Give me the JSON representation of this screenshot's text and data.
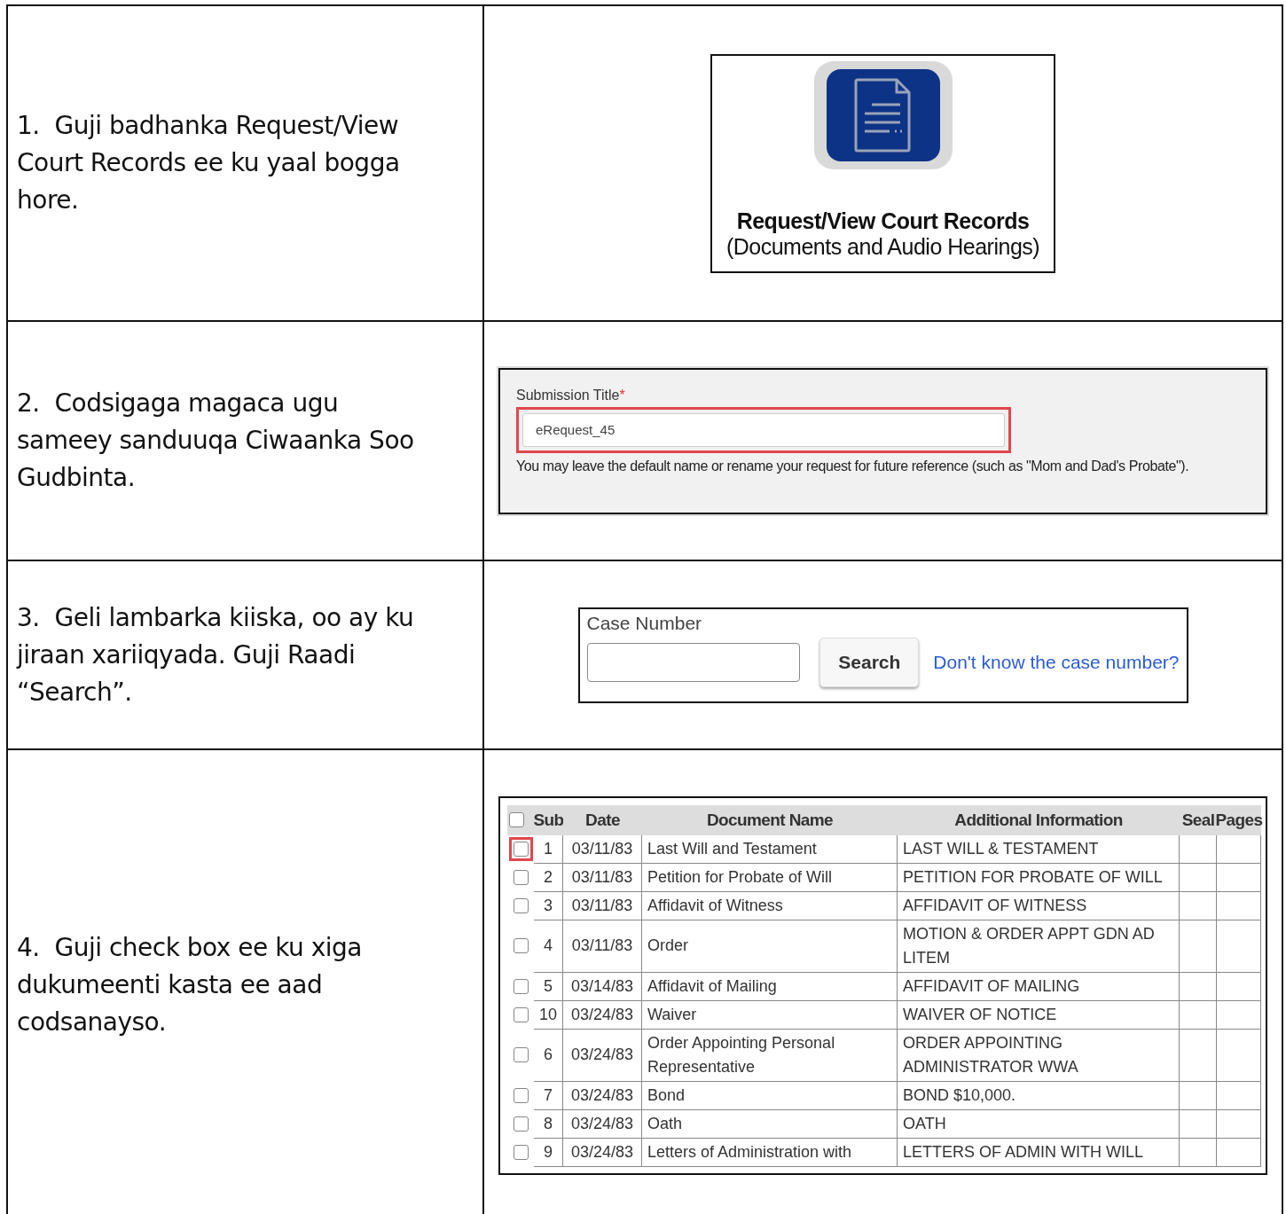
{
  "steps": [
    {
      "number": "1.",
      "text": "Guji badhanka Request/View Court Records ee ku yaal bogga hore.",
      "kind": "tile"
    },
    {
      "number": "2.",
      "text": "Codsigaga magaca ugu sameey sanduuqa Ciwaanka Soo Gudbinta.",
      "kind": "title_form"
    },
    {
      "number": "3.",
      "text": "Geli lambarka kiiska, oo ay ku jiraan xariiqyada. Guji Raadi “Search”.",
      "kind": "case_search"
    },
    {
      "number": "4.",
      "text": "Guji check box ee ku xiga dukumeenti kasta ee aad codsanayso.",
      "kind": "documents"
    }
  ],
  "tile": {
    "title": "Request/View Court Records",
    "subtitle": "(Documents and Audio Hearings)"
  },
  "title_form": {
    "label": "Submission Title",
    "required_mark": "*",
    "value": "eRequest_45",
    "highlighted": true,
    "help": "You may leave the default name or rename your request for future reference (such as \"Mom and Dad's Probate\")."
  },
  "case_search": {
    "label": "Case Number",
    "button": "Search",
    "link": "Don't know the case number?"
  },
  "documents": {
    "select_all": {
      "checked": false
    },
    "columns": [
      "Sub",
      "Date",
      "Document Name",
      "Additional Information",
      "Seal",
      "Pages"
    ],
    "rows": [
      {
        "sub": "1",
        "date": "03/11/83",
        "name": "Last Will and Testament",
        "info": "LAST WILL & TESTAMENT",
        "checked": false,
        "highlighted": true
      },
      {
        "sub": "2",
        "date": "03/11/83",
        "name": "Petition for Probate of Will",
        "info": "PETITION FOR PROBATE OF WILL",
        "checked": false,
        "highlighted": false
      },
      {
        "sub": "3",
        "date": "03/11/83",
        "name": "Affidavit of Witness",
        "info": "AFFIDAVIT OF WITNESS",
        "checked": false,
        "highlighted": false
      },
      {
        "sub": "4",
        "date": "03/11/83",
        "name": "Order",
        "info": "MOTION & ORDER APPT GDN AD LITEM",
        "checked": false,
        "highlighted": false
      },
      {
        "sub": "5",
        "date": "03/14/83",
        "name": "Affidavit of Mailing",
        "info": "AFFIDAVIT OF MAILING",
        "checked": false,
        "highlighted": false
      },
      {
        "sub": "10",
        "date": "03/24/83",
        "name": "Waiver",
        "info": "WAIVER OF NOTICE",
        "checked": false,
        "highlighted": false
      },
      {
        "sub": "6",
        "date": "03/24/83",
        "name": "Order Appointing Personal Representative",
        "info": "ORDER APPOINTING ADMINISTRATOR WWA",
        "checked": false,
        "highlighted": false
      },
      {
        "sub": "7",
        "date": "03/24/83",
        "name": "Bond",
        "info": "BOND $10,000.",
        "checked": false,
        "highlighted": false
      },
      {
        "sub": "8",
        "date": "03/24/83",
        "name": "Oath",
        "info": "OATH",
        "checked": false,
        "highlighted": false
      },
      {
        "sub": "9",
        "date": "03/24/83",
        "name": "Letters of Administration with",
        "info": "LETTERS OF ADMIN WITH WILL",
        "checked": false,
        "highlighted": false
      }
    ]
  }
}
